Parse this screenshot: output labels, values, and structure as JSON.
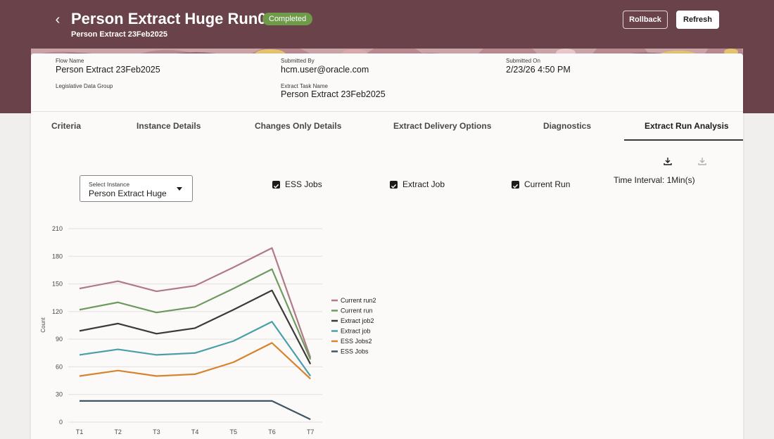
{
  "header": {
    "back_icon": "chevron-left-icon",
    "title": "Person Extract Huge Run02",
    "status": "Completed",
    "subtitle": "Person Extract 23Feb2025",
    "rollback_label": "Rollback",
    "refresh_label": "Refresh",
    "banner_color": "#6a4249",
    "status_color": "#6e9a4a"
  },
  "details": {
    "flow_name_label": "Flow Name",
    "flow_name_value": "Person Extract 23Feb2025",
    "submitted_by_label": "Submitted By",
    "submitted_by_value": "hcm.user@oracle.com",
    "submitted_on_label": "Submitted On",
    "submitted_on_value": "2/23/26 4:50 PM",
    "ldg_label": "Legislative Data Group",
    "extract_task_label": "Extract Task Name",
    "extract_task_value": "Person Extract 23Feb2025"
  },
  "tabs": [
    {
      "label": "Criteria"
    },
    {
      "label": "Instance Details"
    },
    {
      "label": "Changes Only Details"
    },
    {
      "label": "Extract Delivery Options"
    },
    {
      "label": "Diagnostics"
    },
    {
      "label": "Extract Run Analysis",
      "active": true
    }
  ],
  "analysis": {
    "download_icon": "download-icon",
    "download_disabled_icon": "download-disabled-icon",
    "select_label": "Select Instance",
    "select_value": "Person Extract Huge",
    "checkboxes": [
      {
        "label": "ESS Jobs",
        "checked": true
      },
      {
        "label": "Extract Job",
        "checked": true
      },
      {
        "label": "Current Run",
        "checked": true
      }
    ],
    "time_interval": "Time Interval: 1Min(s)"
  },
  "chart_data": {
    "type": "line",
    "title": "",
    "xlabel": "",
    "ylabel": "Count",
    "categories": [
      "T1",
      "T2",
      "T3",
      "T4",
      "T5",
      "T6",
      "T7"
    ],
    "ylim": [
      0,
      210
    ],
    "yticks": [
      0,
      30,
      60,
      90,
      120,
      150,
      180,
      210
    ],
    "grid": true,
    "legend_position": "right",
    "series": [
      {
        "name": "Current run2",
        "color": "#b07a86",
        "values": [
          145,
          153,
          142,
          148,
          168,
          189,
          70
        ]
      },
      {
        "name": "Current run",
        "color": "#6e9a5f",
        "values": [
          122,
          130,
          119,
          125,
          145,
          166,
          68
        ]
      },
      {
        "name": "Extract job2",
        "color": "#3b3a38",
        "values": [
          99,
          107,
          96,
          102,
          122,
          143,
          63
        ]
      },
      {
        "name": "Extract job",
        "color": "#4a9faa",
        "values": [
          73,
          79,
          73,
          75,
          88,
          109,
          50
        ]
      },
      {
        "name": "ESS Jobs2",
        "color": "#d6832e",
        "values": [
          50,
          56,
          50,
          52,
          65,
          86,
          47
        ]
      },
      {
        "name": "ESS Jobs",
        "color": "#3d5763",
        "values": [
          23,
          23,
          23,
          23,
          23,
          23,
          3
        ]
      }
    ]
  }
}
